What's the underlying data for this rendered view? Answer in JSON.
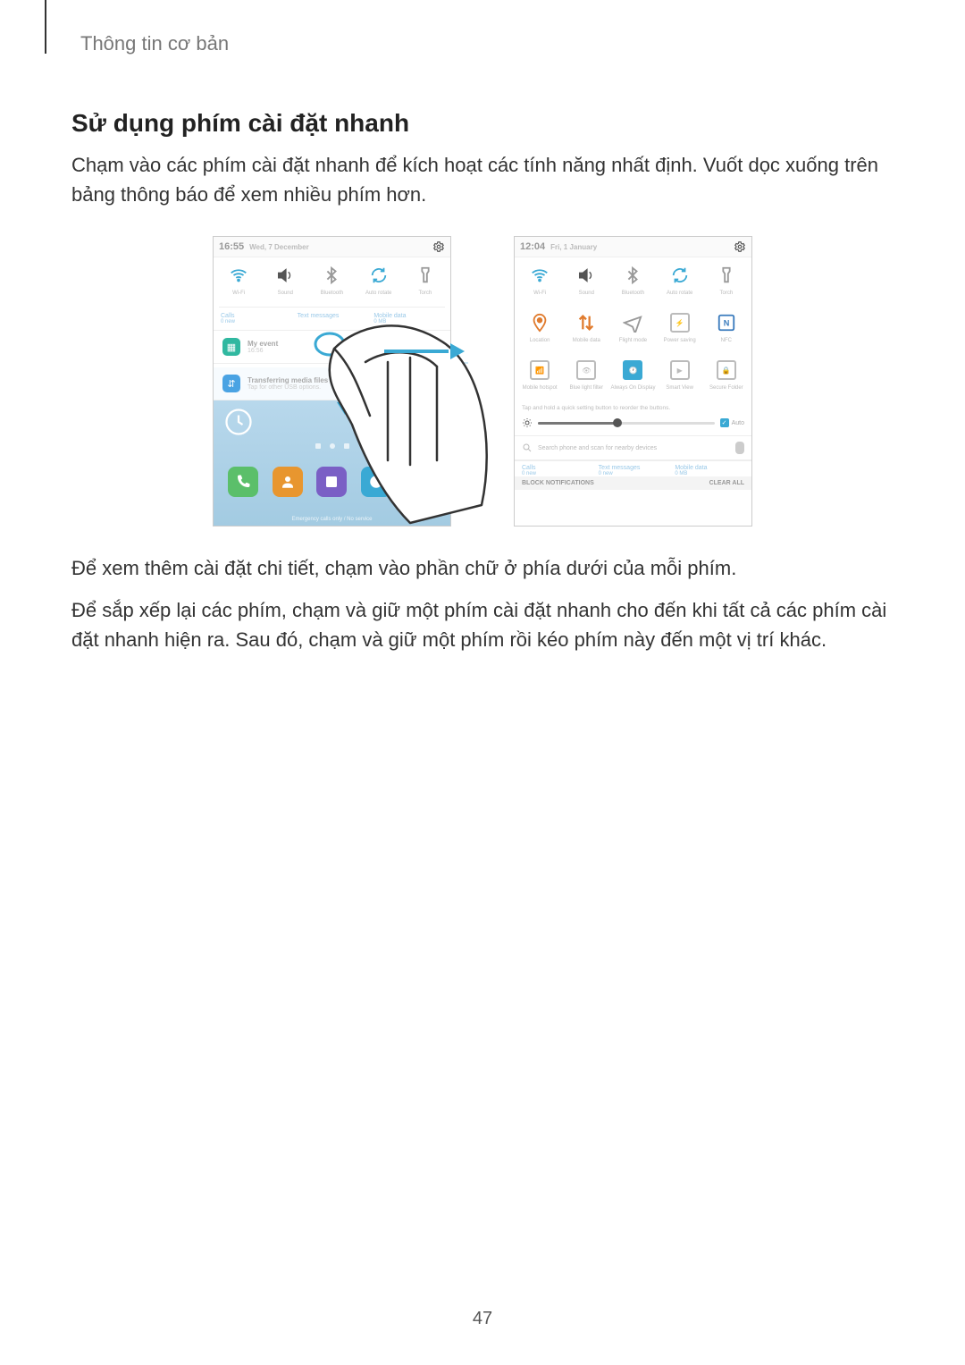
{
  "header": "Thông tin cơ bản",
  "section_title": "Sử dụng phím cài đặt nhanh",
  "intro": "Chạm vào các phím cài đặt nhanh để kích hoạt các tính năng nhất định. Vuốt dọc xuống trên bảng thông báo để xem nhiều phím hơn.",
  "after_figure_p1": "Để xem thêm cài đặt chi tiết, chạm vào phần chữ ở phía dưới của mỗi phím.",
  "after_figure_p2": "Để sắp xếp lại các phím, chạm và giữ một phím cài đặt nhanh cho đến khi tất cả các phím cài đặt nhanh hiện ra. Sau đó, chạm và giữ một phím rồi kéo phím này đến một vị trí khác.",
  "page_number": "47",
  "left_phone": {
    "time": "16:55",
    "date": "Wed, 7 December",
    "qs_row1": [
      "Wi-Fi",
      "Sound",
      "Bluetooth",
      "Auto rotate",
      "Torch"
    ],
    "notif_cols": [
      {
        "t": "Calls",
        "s": "0 new"
      },
      {
        "t": "Text messages",
        "s": ""
      },
      {
        "t": "Mobile data",
        "s": "0 MB"
      }
    ],
    "cards": [
      {
        "badge": "teal",
        "glyph": "▦",
        "t": "My event",
        "s": "16:56"
      },
      {
        "badge": "blue",
        "glyph": "⇵",
        "t": "Transferring media files via USB",
        "s": "Tap for other USB options."
      }
    ],
    "emergency": "Emergency calls only / No service"
  },
  "right_phone": {
    "time": "12:04",
    "date": "Fri, 1 January",
    "qs_row1": [
      "Wi-Fi",
      "Sound",
      "Bluetooth",
      "Auto rotate",
      "Torch"
    ],
    "qs_row2": [
      "Location",
      "Mobile data",
      "Flight mode",
      "Power saving",
      "NFC"
    ],
    "qs_row3": [
      "Mobile hotspot",
      "Blue light filter",
      "Always On Display",
      "Smart View",
      "Secure Folder"
    ],
    "hint": "Tap and hold a quick setting button to reorder the buttons.",
    "auto_label": "Auto",
    "search_placeholder": "Search phone and scan for nearby devices",
    "notif_cols": [
      {
        "t": "Calls",
        "s": "0 new"
      },
      {
        "t": "Text messages",
        "s": "0 new"
      },
      {
        "t": "Mobile data",
        "s": "0 MB"
      }
    ],
    "actions": {
      "block": "BLOCK NOTIFICATIONS",
      "clear": "CLEAR ALL"
    }
  }
}
